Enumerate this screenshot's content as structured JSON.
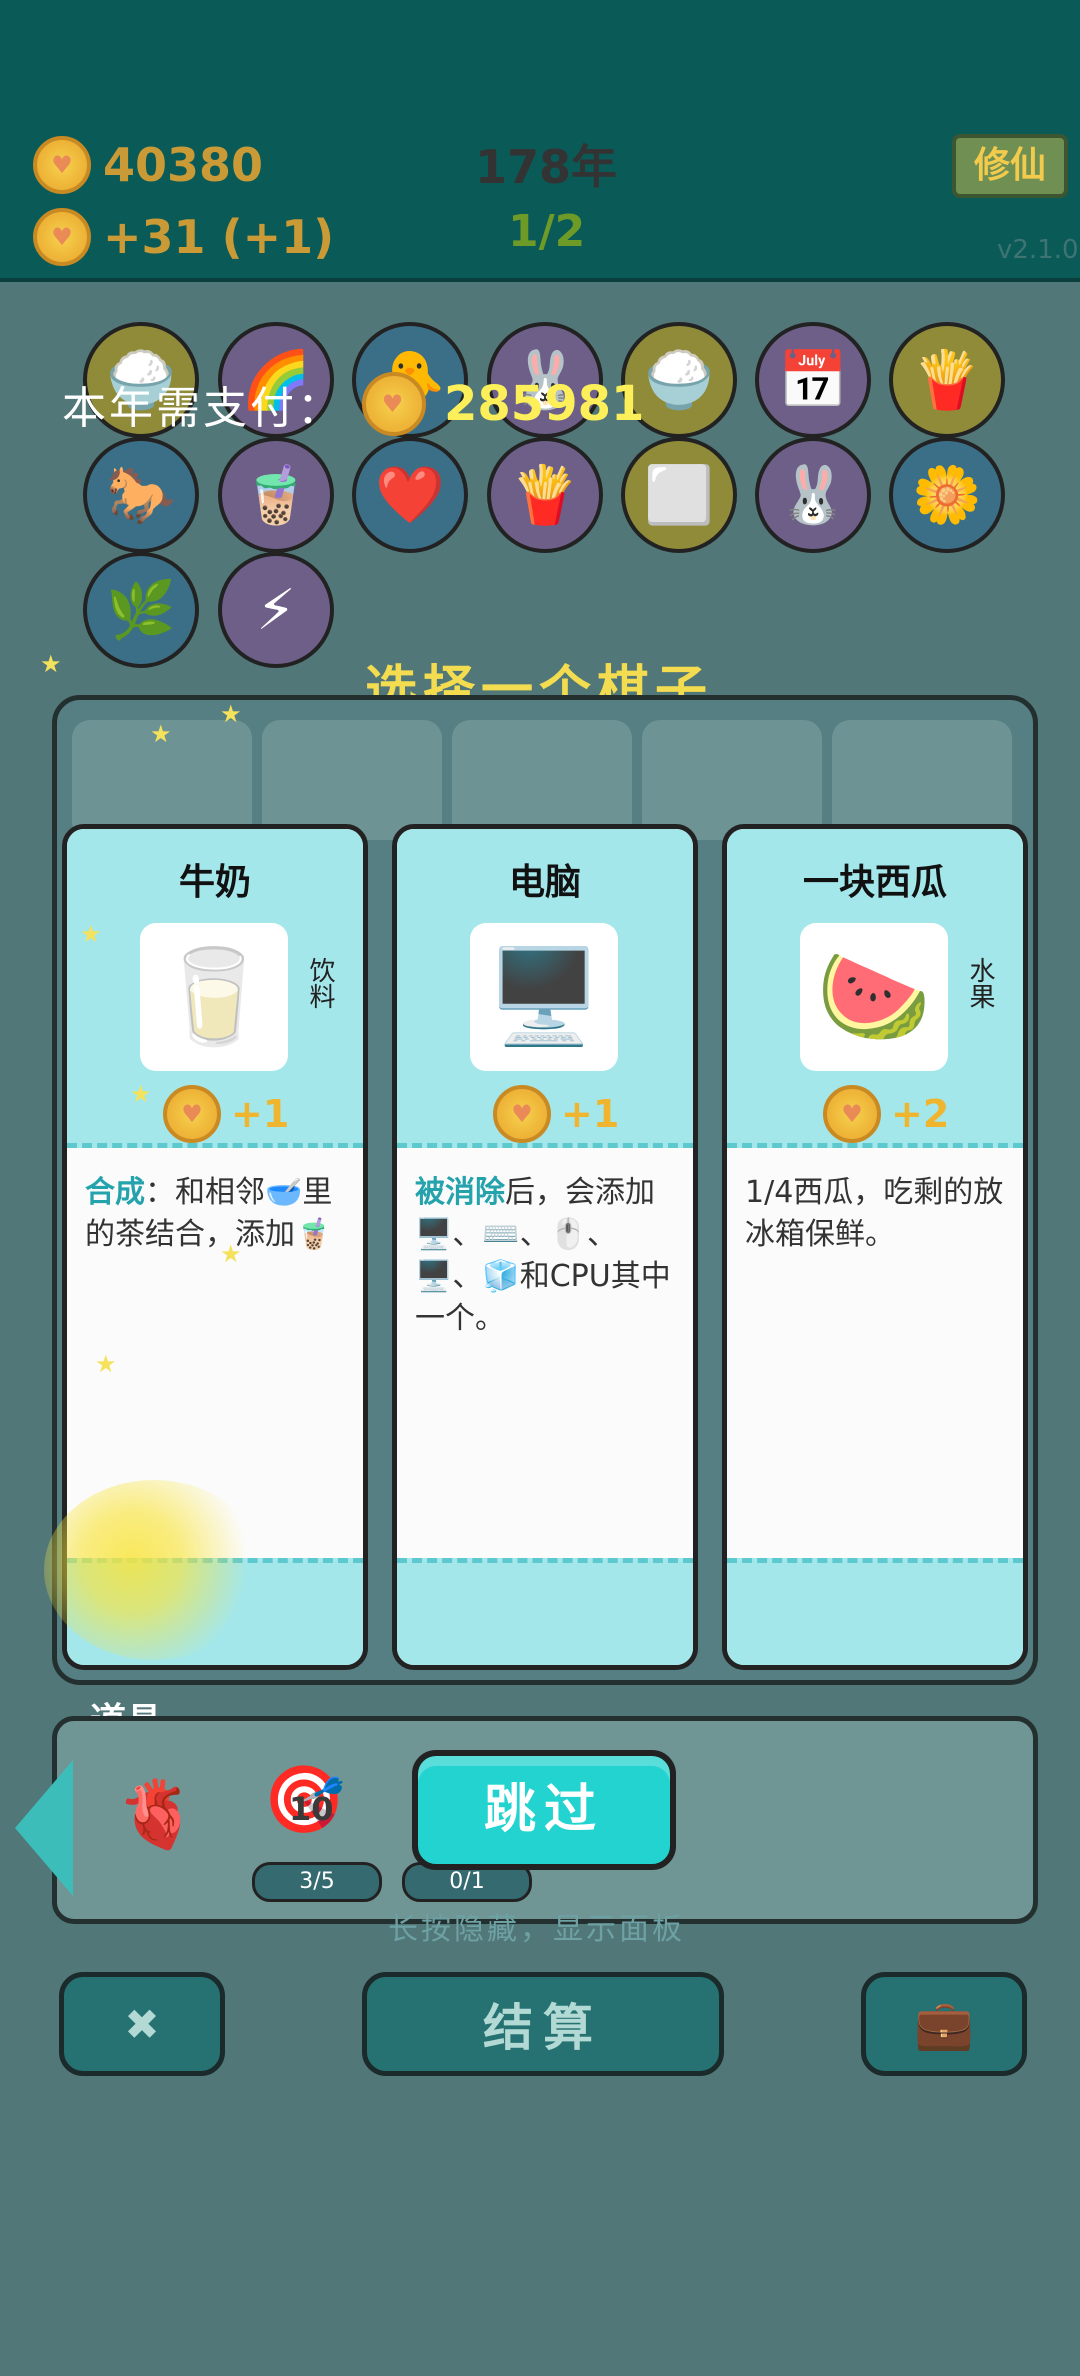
{
  "header": {
    "money": "40380",
    "income": "+31  (+1)",
    "year": "178年",
    "stage": "1/2",
    "cultivate_button": "修仙",
    "version": "v2.1.0"
  },
  "payment": {
    "label": "本年需支付：",
    "amount": "285981"
  },
  "choose_title": "选择一个棋子",
  "cards": [
    {
      "title": "牛奶",
      "category": "饮料",
      "coin_change": "+1",
      "desc_prefix": "合成",
      "desc_text": "：和相邻🥣里的茶结合，添加🧋"
    },
    {
      "title": "电脑",
      "category": "",
      "coin_change": "+1",
      "desc_prefix": "被消除",
      "desc_text": "后，会添加🖥️、⌨️、🖱️、🖥️、🧊和CPU其中一个。"
    },
    {
      "title": "一块西瓜",
      "category": "水果",
      "coin_change": "+2",
      "desc_prefix": "",
      "desc_text": "1/4西瓜，吃剩的放冰箱保鲜。"
    }
  ],
  "tools": {
    "label": "道具",
    "item1_icon": "liver-icon",
    "item2_value": "10",
    "item2_progress": "3/5",
    "item3_progress": "0/1",
    "skip_button": "跳过",
    "hint": "长按隐藏，显示面板"
  },
  "bottom": {
    "left_icon": "close-x-icon",
    "settle_button": "结算",
    "bag_icon": "briefcase-icon"
  },
  "colors": {
    "top_bar": "#0a5a58",
    "card_top": "#a4e7ea",
    "skip": "#22d3d0",
    "accent_gold": "#f3dc4f"
  }
}
